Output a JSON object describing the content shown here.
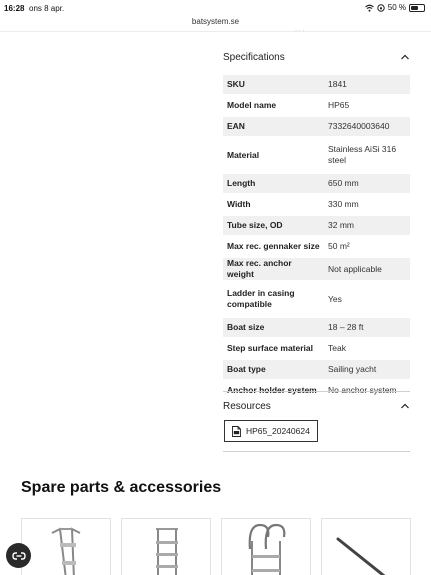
{
  "status": {
    "time": "16:28",
    "date": "ons 8 apr.",
    "battery": "50 %",
    "battery_level": 0.5
  },
  "browser": {
    "url": "batsystem.se"
  },
  "specifications": {
    "title": "Specifications",
    "rows": [
      {
        "key": "SKU",
        "value": "1841"
      },
      {
        "key": "Model name",
        "value": "HP65"
      },
      {
        "key": "EAN",
        "value": "7332640003640"
      },
      {
        "key": "Material",
        "value": "Stainless AiSi 316 steel"
      },
      {
        "key": "Length",
        "value": "650 mm"
      },
      {
        "key": "Width",
        "value": "330 mm"
      },
      {
        "key": "Tube size, OD",
        "value": "32 mm"
      },
      {
        "key": "Max rec. gennaker size",
        "value": "50 m²"
      },
      {
        "key": "Max rec. anchor weight",
        "value": "Not applicable"
      },
      {
        "key": "Ladder in casing compatible",
        "value": "Yes"
      },
      {
        "key": "Boat size",
        "value": "18 – 28 ft"
      },
      {
        "key": "Step surface material",
        "value": "Teak"
      },
      {
        "key": "Boat type",
        "value": "Sailing yacht"
      },
      {
        "key": "Anchor holder system",
        "value": "No anchor system"
      }
    ]
  },
  "resources": {
    "title": "Resources",
    "file_label": "HP65_20240624",
    "file_icon": "pdf-file-icon"
  },
  "spare_parts": {
    "title": "Spare parts & accessories",
    "cards": [
      {
        "icon": "ladder-product-image"
      },
      {
        "icon": "telescopic-ladder-product-image"
      },
      {
        "icon": "hook-ladder-product-image"
      },
      {
        "icon": "rod-product-image"
      }
    ]
  },
  "chat": {
    "icon": "chat-icon"
  }
}
